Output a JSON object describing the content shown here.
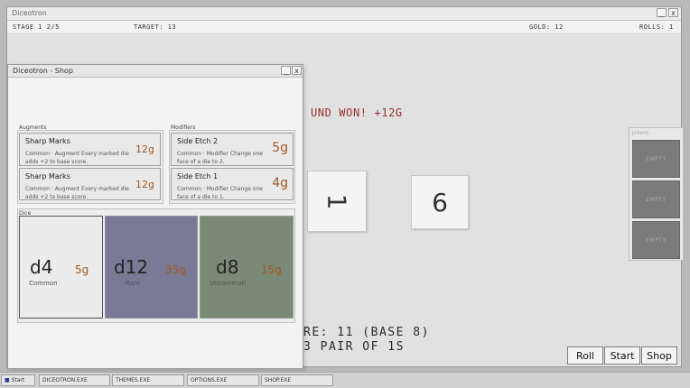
{
  "main_window": {
    "title": "Diceotron"
  },
  "hud": {
    "stage": "STAGE 1  2/5",
    "target": "TARGET: 13",
    "gold": "GOLD: 12",
    "rolls": "ROLLS: 1 / 3"
  },
  "board": {
    "round_message": "UND WON! +12G",
    "dice": [
      "1",
      "6"
    ],
    "score_line": "RE: 11 (BASE 8)",
    "hand_line": "3 PAIR OF 1S"
  },
  "jokers": {
    "title": "Jokers",
    "slots": [
      "EMPTY",
      "EMPTY",
      "EMPTY"
    ]
  },
  "actions": {
    "roll": "Roll",
    "start": "Start",
    "shop": "Shop"
  },
  "shop": {
    "title": "Diceotron - Shop",
    "augments_label": "Augments",
    "modifiers_label": "Modifiers",
    "dice_label": "Dice",
    "augments": [
      {
        "name": "Sharp Marks",
        "desc": "Common · Augment  Every marked die adds +2 to base score.",
        "price": "12g"
      },
      {
        "name": "Sharp Marks",
        "desc": "Common · Augment  Every marked die adds +2 to base score.",
        "price": "12g"
      }
    ],
    "modifiers": [
      {
        "name": "Side Etch  2",
        "desc": "Common · Modifier  Change one face of a die to 2.",
        "price": "5g"
      },
      {
        "name": "Side Etch  1",
        "desc": "Common · Modifier  Change one face of a die to 1.",
        "price": "4g"
      }
    ],
    "dice": [
      {
        "name": "d4",
        "price": "5g",
        "rarity": "Common",
        "color": "#ececec"
      },
      {
        "name": "d12",
        "price": "35g",
        "rarity": "Rare",
        "color": "#797b96"
      },
      {
        "name": "d8",
        "price": "15g",
        "rarity": "Uncommon",
        "color": "#7b8a76"
      }
    ]
  },
  "taskbar": {
    "start": "Start",
    "items": [
      "DICEOTRON.EXE",
      "THEMES.EXE",
      "OPTIONS.EXE",
      "SHOP.EXE"
    ]
  },
  "colors": {
    "accent_red": "#9c2f2f",
    "price": "#a2581f"
  }
}
